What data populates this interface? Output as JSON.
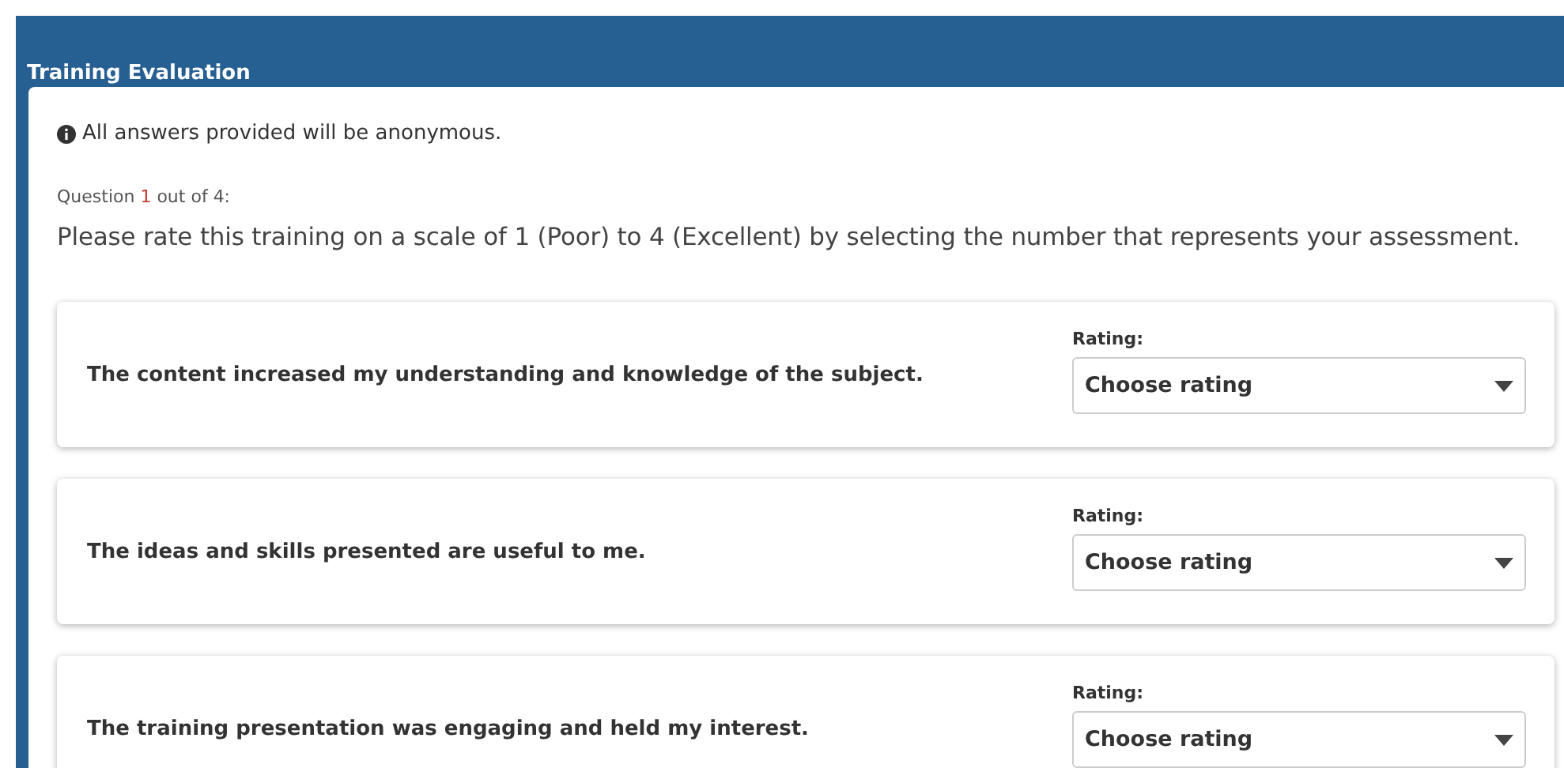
{
  "header": {
    "title": "Training Evaluation"
  },
  "notice": "All answers provided will be anonymous.",
  "progress": {
    "prefix": "Question",
    "current": "1",
    "suffix": "out of 4:"
  },
  "instructions": "Please rate this training on a scale of 1 (Poor) to 4 (Excellent) by selecting the number that represents your assessment.",
  "questions": [
    {
      "text": "The content increased my understanding and knowledge of the subject.",
      "label": "Rating:",
      "placeholder": "Choose rating"
    },
    {
      "text": "The ideas and skills presented are useful to me.",
      "label": "Rating:",
      "placeholder": "Choose rating"
    },
    {
      "text": "The training presentation was engaging and held my interest.",
      "label": "Rating:",
      "placeholder": "Choose rating"
    }
  ]
}
